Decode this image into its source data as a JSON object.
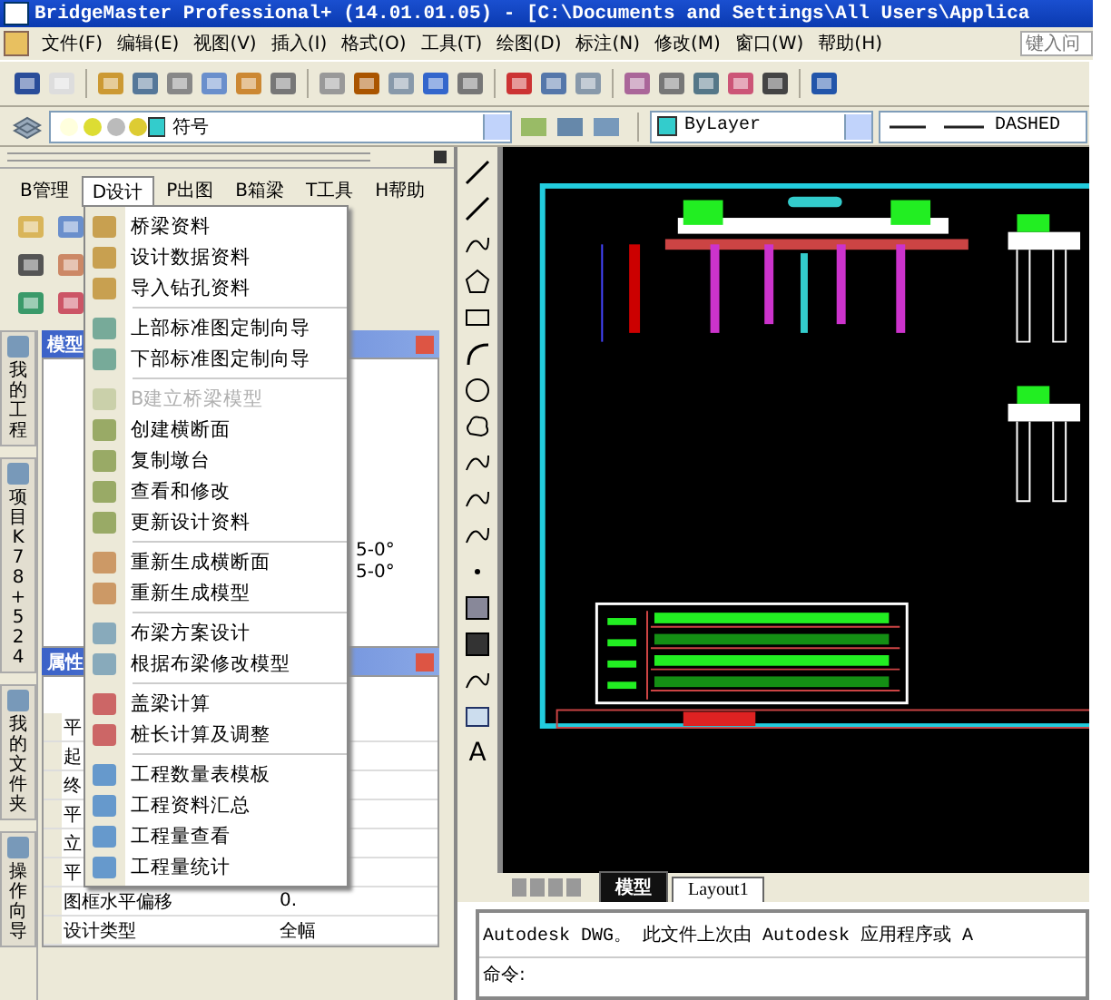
{
  "window": {
    "title": "BridgeMaster Professional+ (14.01.01.05) - [C:\\Documents and Settings\\All Users\\Applica"
  },
  "menu_bar": {
    "items": [
      "文件(F)",
      "编辑(E)",
      "视图(V)",
      "插入(I)",
      "格式(O)",
      "工具(T)",
      "绘图(D)",
      "标注(N)",
      "修改(M)",
      "窗口(W)",
      "帮助(H)"
    ],
    "search": {
      "placeholder": "键入问"
    }
  },
  "layer_toolbar": {
    "layer": "符号",
    "color_setting": "ByLayer",
    "linetype": "DASHED"
  },
  "side_panel": {
    "tabs": [
      {
        "label": "B管理",
        "selected": false
      },
      {
        "label": "D设计",
        "selected": true
      },
      {
        "label": "P出图",
        "selected": false
      },
      {
        "label": "B箱梁",
        "selected": false
      },
      {
        "label": "T工具",
        "selected": false
      },
      {
        "label": "H帮助",
        "selected": false
      }
    ],
    "vertical_tabs": [
      "我的工程",
      "项目K78+524",
      "我的文件夹",
      "操作向导"
    ],
    "model_panel": {
      "title": "模型",
      "tree_rows": [
        "5-0°",
        "5-0°"
      ]
    },
    "properties_panel": {
      "title": "属性",
      "rows": [
        {
          "name": "平"
        },
        {
          "name": "起"
        },
        {
          "name": "终"
        },
        {
          "name": "平"
        },
        {
          "name": "立"
        },
        {
          "name": "平"
        },
        {
          "name": "图框水平偏移",
          "value": "0."
        },
        {
          "name": "设计类型",
          "value": "全幅"
        }
      ]
    }
  },
  "design_menu": {
    "groups": [
      [
        {
          "label": "桥梁资料",
          "disabled": false
        },
        {
          "label": "设计数据资料",
          "disabled": false
        },
        {
          "label": "导入钻孔资料",
          "disabled": false
        }
      ],
      [
        {
          "label": "上部标准图定制向导",
          "disabled": false
        },
        {
          "label": "下部标准图定制向导",
          "disabled": false
        }
      ],
      [
        {
          "label": "B建立桥梁模型",
          "disabled": true
        },
        {
          "label": "创建横断面",
          "disabled": false
        },
        {
          "label": "复制墩台",
          "disabled": false
        },
        {
          "label": "查看和修改",
          "disabled": false
        },
        {
          "label": "更新设计资料",
          "disabled": false
        }
      ],
      [
        {
          "label": "重新生成横断面",
          "disabled": false
        },
        {
          "label": "重新生成模型",
          "disabled": false
        }
      ],
      [
        {
          "label": "布梁方案设计",
          "disabled": false
        },
        {
          "label": "根据布梁修改模型",
          "disabled": false
        }
      ],
      [
        {
          "label": "盖梁计算",
          "disabled": false
        },
        {
          "label": "桩长计算及调整",
          "disabled": false
        }
      ],
      [
        {
          "label": "工程数量表模板",
          "disabled": false
        },
        {
          "label": "工程资料汇总",
          "disabled": false
        },
        {
          "label": "工程量查看",
          "disabled": false
        },
        {
          "label": "工程量统计",
          "disabled": false
        }
      ]
    ]
  },
  "draw_toolbar": {
    "text_glyph": "A"
  },
  "layout_tabs": [
    {
      "label": "模型",
      "selected": true
    },
    {
      "label": "Layout1",
      "selected": false
    }
  ],
  "command_line": {
    "history": "Autodesk DWG。  此文件上次由 Autodesk 应用程序或 A",
    "prompt": "命令:"
  }
}
